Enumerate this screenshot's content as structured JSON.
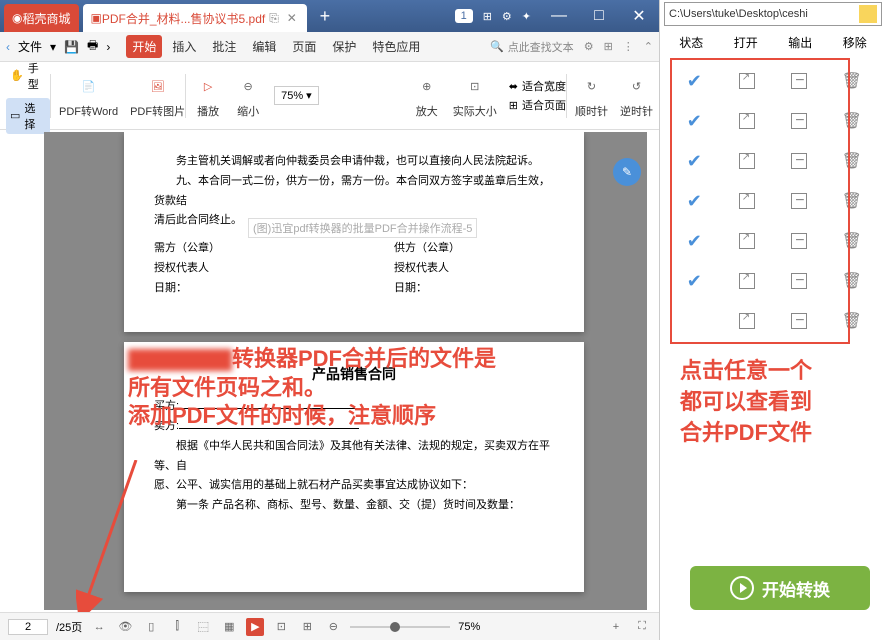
{
  "titlebar": {
    "store_tab": "稻壳商城",
    "active_tab": "PDF合并_材料...售协议书5.pdf",
    "badge": "1"
  },
  "menubar": {
    "file": "文件",
    "tabs": [
      "开始",
      "插入",
      "批注",
      "编辑",
      "页面",
      "保护",
      "特色应用"
    ],
    "search_hint": "点此查找文本"
  },
  "side": {
    "hand": "手型",
    "select": "选择"
  },
  "toolbar": {
    "pdf2word": "PDF转Word",
    "pdf2img": "PDF转图片",
    "play": "播放",
    "shrink": "缩小",
    "zoom": "75%",
    "enlarge": "放大",
    "actual": "实际大小",
    "fit_width": "适合宽度",
    "fit_page": "适合页面",
    "cw": "顺时针",
    "ccw": "逆时针"
  },
  "doc": {
    "line1": "务主管机关调解或者向仲裁委员会申请仲裁，也可以直接向人民法院起诉。",
    "line2": "九、本合同一式二份，供方一份，需方一份。本合同双方签字或盖章后生效，货款结",
    "line3": "清后此合同终止。",
    "sig_a": "需方（公章）",
    "sig_b": "供方（公章）",
    "rep": "授权代表人",
    "date": "日期：",
    "contract_title": "产品销售合同",
    "buyer": "买方:",
    "seller": "卖方:",
    "body1": "根据《中华人民共和国合同法》及其他有关法律、法规的规定，买卖双方在平等、自",
    "body2": "愿、公平、诚实信用的基础上就石材产品买卖事宜达成协议如下：",
    "body3": "第一条  产品名称、商标、型号、数量、金额、交（提）货时间及数量："
  },
  "tooltip": "(图)迅宜pdf转换器的批量PDF合并操作流程-5",
  "annotation1": {
    "l1a": "转换器PDF合并后的文件是",
    "l2": "所有文件页码之和。",
    "l3": "添加PDF文件的时候，注意顺序"
  },
  "annotation2": {
    "l1": "点击任意一个",
    "l2": "都可以查看到",
    "l3": "合并PDF文件"
  },
  "status": {
    "page": "2",
    "total": "/25页",
    "zoom": "75%"
  },
  "right": {
    "path": "C:\\Users\\tuke\\Desktop\\ceshi",
    "cols": [
      "状态",
      "打开",
      "输出",
      "移除"
    ],
    "start": "开始转换"
  }
}
